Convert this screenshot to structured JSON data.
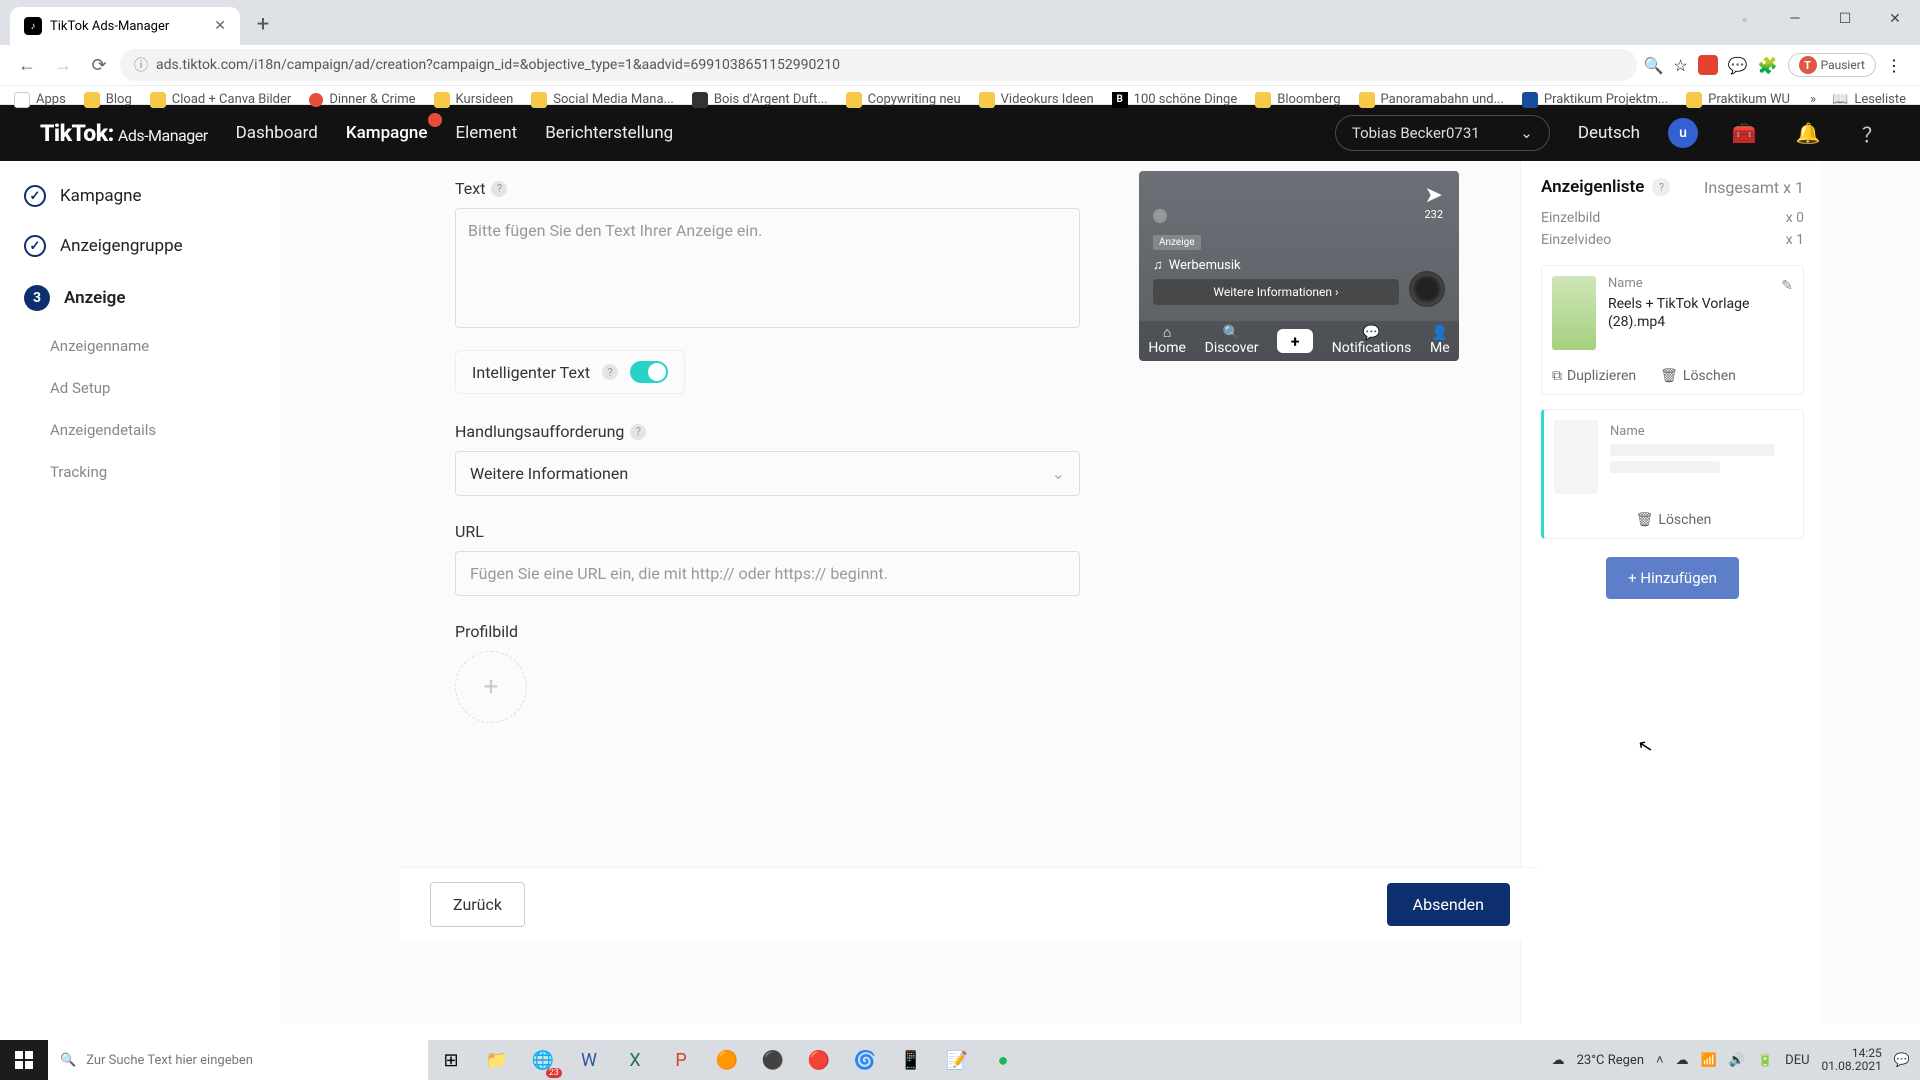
{
  "browser": {
    "tab_title": "TikTok Ads-Manager",
    "url": "ads.tiktok.com/i18n/campaign/ad/creation?campaign_id=&objective_type=1&aadvid=6991038651152990210",
    "profile_chip": "Pausiert",
    "bookmarks": [
      "Apps",
      "Blog",
      "Cload + Canva Bilder",
      "Dinner & Crime",
      "Kursideen",
      "Social Media Mana...",
      "Bois d'Argent Duft...",
      "Copywriting neu",
      "Videokurs Ideen",
      "100 schöne Dinge",
      "Bloomberg",
      "Panoramabahn und...",
      "Praktikum Projektm...",
      "Praktikum WU"
    ],
    "more": "»",
    "readlist": "Leseliste"
  },
  "header": {
    "logo_main": "TikTok:",
    "logo_sub": "Ads-Manager",
    "nav": [
      "Dashboard",
      "Kampagne",
      "Element",
      "Berichterstellung"
    ],
    "account": "Tobias Becker0731",
    "lang": "Deutsch",
    "avatar": "u"
  },
  "steps": {
    "s1": "Kampagne",
    "s2": "Anzeigengruppe",
    "s3": "Anzeige",
    "s3_num": "3",
    "subs": [
      "Anzeigenname",
      "Ad Setup",
      "Anzeigendetails",
      "Tracking"
    ]
  },
  "form": {
    "text_label": "Text",
    "text_placeholder": "Bitte fügen Sie den Text Ihrer Anzeige ein.",
    "smart_text": "Intelligenter Text",
    "cta_label": "Handlungsaufforderung",
    "cta_value": "Weitere Informationen",
    "url_label": "URL",
    "url_placeholder": "Fügen Sie eine URL ein, die mit http:// oder https:// beginnt.",
    "profile_label": "Profilbild"
  },
  "preview": {
    "share_count": "232",
    "ad_tag": "Anzeige",
    "music": "Werbemusik",
    "cta": "Weitere Informationen ›",
    "nav": {
      "home": "Home",
      "discover": "Discover",
      "notif": "Notifications",
      "me": "Me"
    }
  },
  "right": {
    "title": "Anzeigenliste",
    "total": "Insgesamt x 1",
    "stat1_l": "Einzelbild",
    "stat1_r": "x 0",
    "stat2_l": "Einzelvideo",
    "stat2_r": "x 1",
    "card_name_lbl": "Name",
    "card_name": "Reels + TikTok Vorlage (28).mp4",
    "dup": "Duplizieren",
    "del": "Löschen",
    "placeholder_lbl": "Name",
    "placeholder_del": "Löschen",
    "add": "+ Hinzufügen"
  },
  "footer": {
    "back": "Zurück",
    "submit": "Absenden"
  },
  "taskbar": {
    "search": "Zur Suche Text hier eingeben",
    "weather": "23°C  Regen",
    "lang": "DEU",
    "time": "14:25",
    "date": "01.08.2021",
    "edge_badge": "23"
  }
}
